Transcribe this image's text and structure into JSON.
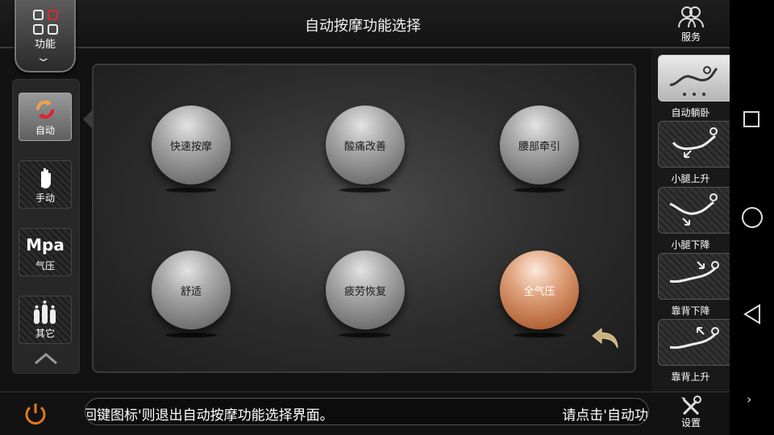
{
  "header": {
    "title": "自动按摩功能选择"
  },
  "function_button": {
    "label": "功能"
  },
  "left_menu": [
    {
      "label": "自动",
      "icon": "auto-refresh-icon",
      "active": true
    },
    {
      "label": "手动",
      "icon": "hand-icon",
      "active": false
    },
    {
      "label": "气压",
      "icon_text": "Mpa",
      "icon": "air-pressure-icon",
      "active": false
    },
    {
      "label": "其它",
      "icon": "bottles-icon",
      "active": false
    }
  ],
  "programs": [
    {
      "label": "快速按摩",
      "selected": false
    },
    {
      "label": "酸痛改善",
      "selected": false
    },
    {
      "label": "腰部牵引",
      "selected": false
    },
    {
      "label": "舒适",
      "selected": false
    },
    {
      "label": "疲劳恢复",
      "selected": false
    },
    {
      "label": "全气压",
      "selected": true
    }
  ],
  "right_menu": {
    "service_label": "服务",
    "items": [
      {
        "label": "自动躺卧",
        "icon": "recline-chair-icon"
      },
      {
        "label": "小腿上升",
        "icon": "leg-up-icon"
      },
      {
        "label": "小腿下降",
        "icon": "leg-down-icon"
      },
      {
        "label": "靠背下降",
        "icon": "back-down-icon"
      },
      {
        "label": "靠背上升",
        "icon": "back-up-icon"
      }
    ]
  },
  "footer": {
    "marquee_left": "返回键图标'则退出自动按摩功能选择界面。",
    "marquee_right": "请点击'自动功",
    "settings_label": "设置"
  },
  "colors": {
    "accent": "#c8764a",
    "power": "#e07a1c"
  }
}
